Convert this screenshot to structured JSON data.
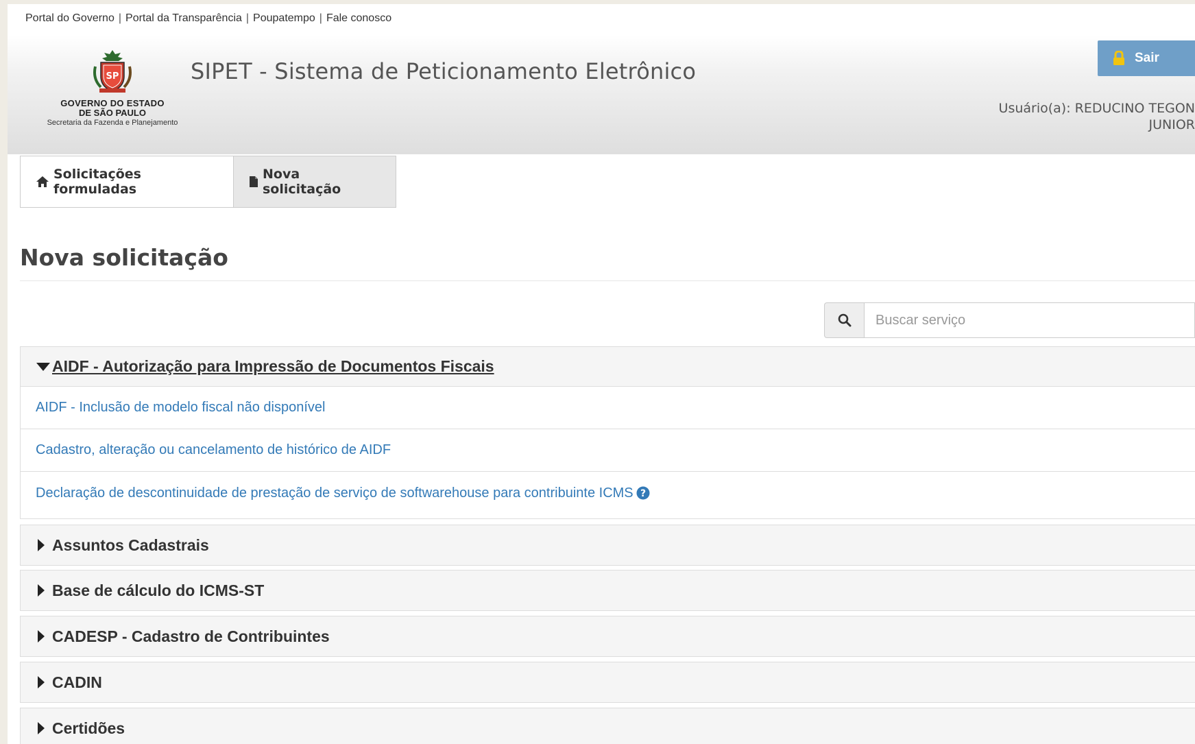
{
  "top_links": {
    "items": [
      "Portal do Governo",
      "Portal da Transparência",
      "Poupatempo",
      "Fale conosco"
    ],
    "separator": "|"
  },
  "header": {
    "logo": {
      "line1": "GOVERNO DO ESTADO",
      "line2": "DE SÃO PAULO",
      "line3": "Secretaria da Fazenda e Planejamento",
      "icon": "coat-of-arms-sao-paulo"
    },
    "app_title": "SIPET - Sistema de Peticionamento Eletrônico",
    "logout_label": "Sair",
    "user_line1": "Usuário(a): REDUCINO TEGON",
    "user_line2": "JUNIOR"
  },
  "tabs": [
    {
      "label": "Solicitações formuladas",
      "icon": "home-icon"
    },
    {
      "label": "Nova solicitação",
      "icon": "file-icon"
    }
  ],
  "page_title": "Nova solicitação",
  "search": {
    "placeholder": "Buscar serviço",
    "value": ""
  },
  "open_category": {
    "title": "AIDF - Autorização para Impressão de Documentos Fiscais",
    "services": [
      "AIDF - Inclusão de modelo fiscal não disponível",
      "Cadastro, alteração ou cancelamento de histórico de AIDF",
      "Declaração de descontinuidade de prestação de serviço de softwarehouse para contribuinte ICMS"
    ]
  },
  "categories": [
    "Assuntos Cadastrais",
    "Base de cálculo do ICMS-ST",
    "CADESP - Cadastro de Contribuintes",
    "CADIN",
    "Certidões"
  ],
  "colors": {
    "link": "#337ab7",
    "logout_button": "#6f9fc8",
    "background": "#efece4"
  }
}
